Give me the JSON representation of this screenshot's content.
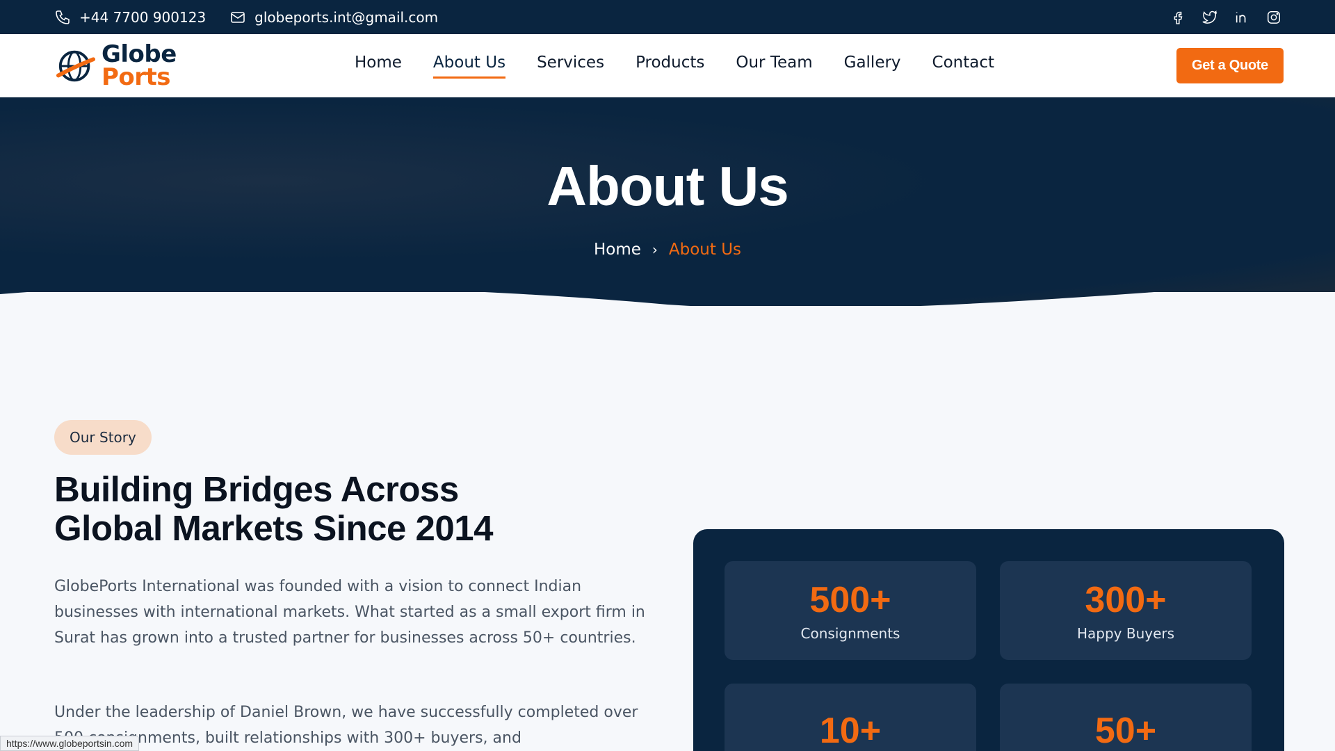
{
  "topbar": {
    "phone": "+44 7700 900123",
    "email": "globeports.int@gmail.com",
    "socials": [
      "facebook-icon",
      "twitter-icon",
      "linkedin-icon",
      "instagram-icon"
    ]
  },
  "header": {
    "logo_line1": "Globe",
    "logo_line2": "Ports",
    "nav": [
      {
        "label": "Home"
      },
      {
        "label": "About Us",
        "active": true
      },
      {
        "label": "Services"
      },
      {
        "label": "Products"
      },
      {
        "label": "Our Team"
      },
      {
        "label": "Gallery"
      },
      {
        "label": "Contact"
      }
    ],
    "cta_label": "Get a Quote"
  },
  "hero": {
    "title": "About Us",
    "breadcrumb_home": "Home",
    "breadcrumb_sep": "›",
    "breadcrumb_current": "About Us"
  },
  "story": {
    "tag": "Our Story",
    "heading_line1": "Building Bridges Across",
    "heading_line2": "Global Markets Since 2014",
    "para1": "GlobePorts International was founded with a vision to connect Indian businesses with international markets. What started as a small export firm in Surat has grown into a trusted partner for businesses across 50+ countries.",
    "para2": "Under the leadership of Daniel Brown, we have successfully completed over 500 consignments, built relationships with 300+ buyers, and"
  },
  "stats": [
    {
      "value": "500+",
      "label": "Consignments"
    },
    {
      "value": "300+",
      "label": "Happy Buyers"
    },
    {
      "value": "10+",
      "label": ""
    },
    {
      "value": "50+",
      "label": ""
    }
  ],
  "status_url": "https://www.globeportsin.com",
  "colors": {
    "navy": "#0a2540",
    "accent": "#f26a12",
    "stat_tile": "#1c3552",
    "tag_bg": "#f7dcc9"
  }
}
